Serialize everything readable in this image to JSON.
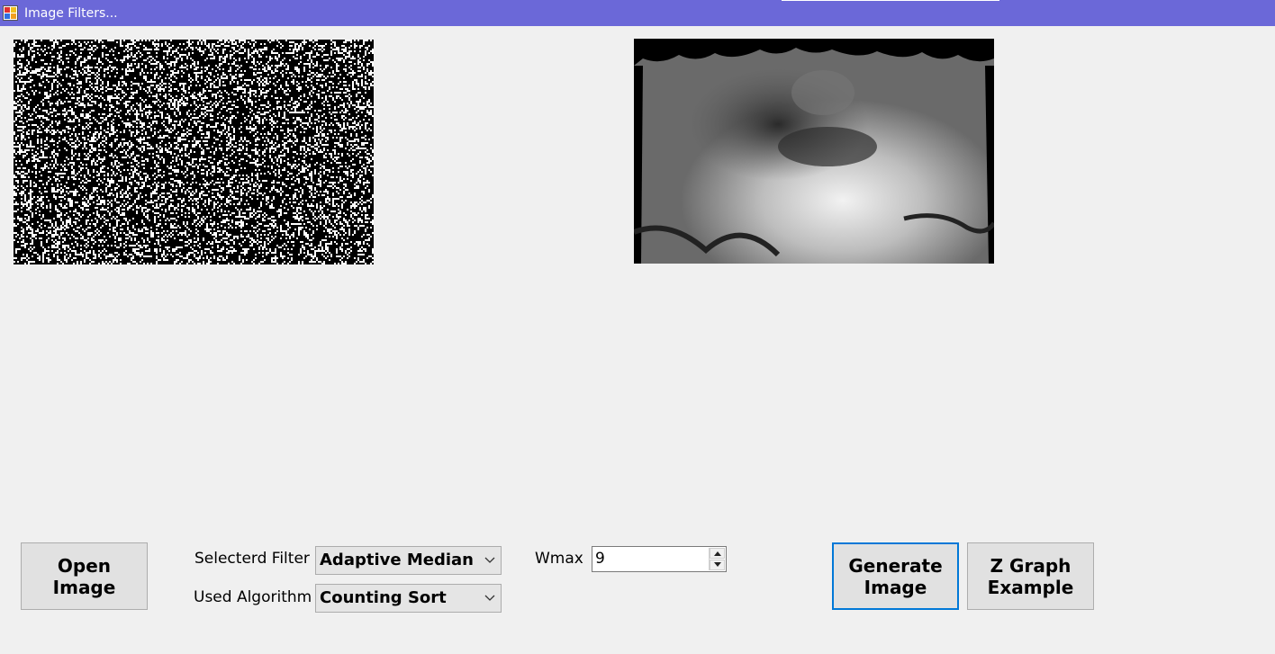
{
  "window": {
    "title": "Image Filters...",
    "icon": "app-window-icon"
  },
  "images": {
    "source": {
      "name": "noisy-input-image",
      "description_icon": "image"
    },
    "output": {
      "name": "filtered-output-image",
      "description_icon": "image"
    }
  },
  "controls": {
    "open_button": "Open\nImage",
    "filter_label": "Selecterd Filter",
    "filter_value": "Adaptive Median",
    "algorithm_label": "Used Algorithm",
    "algorithm_value": "Counting Sort",
    "wmax_label": "Wmax",
    "wmax_value": "9",
    "generate_button": "Generate\nImage",
    "zgraph_button": "Z Graph\nExample"
  },
  "colors": {
    "titlebar": "#6b68d8",
    "background": "#f0f0f0",
    "focus_border": "#0078d7"
  }
}
